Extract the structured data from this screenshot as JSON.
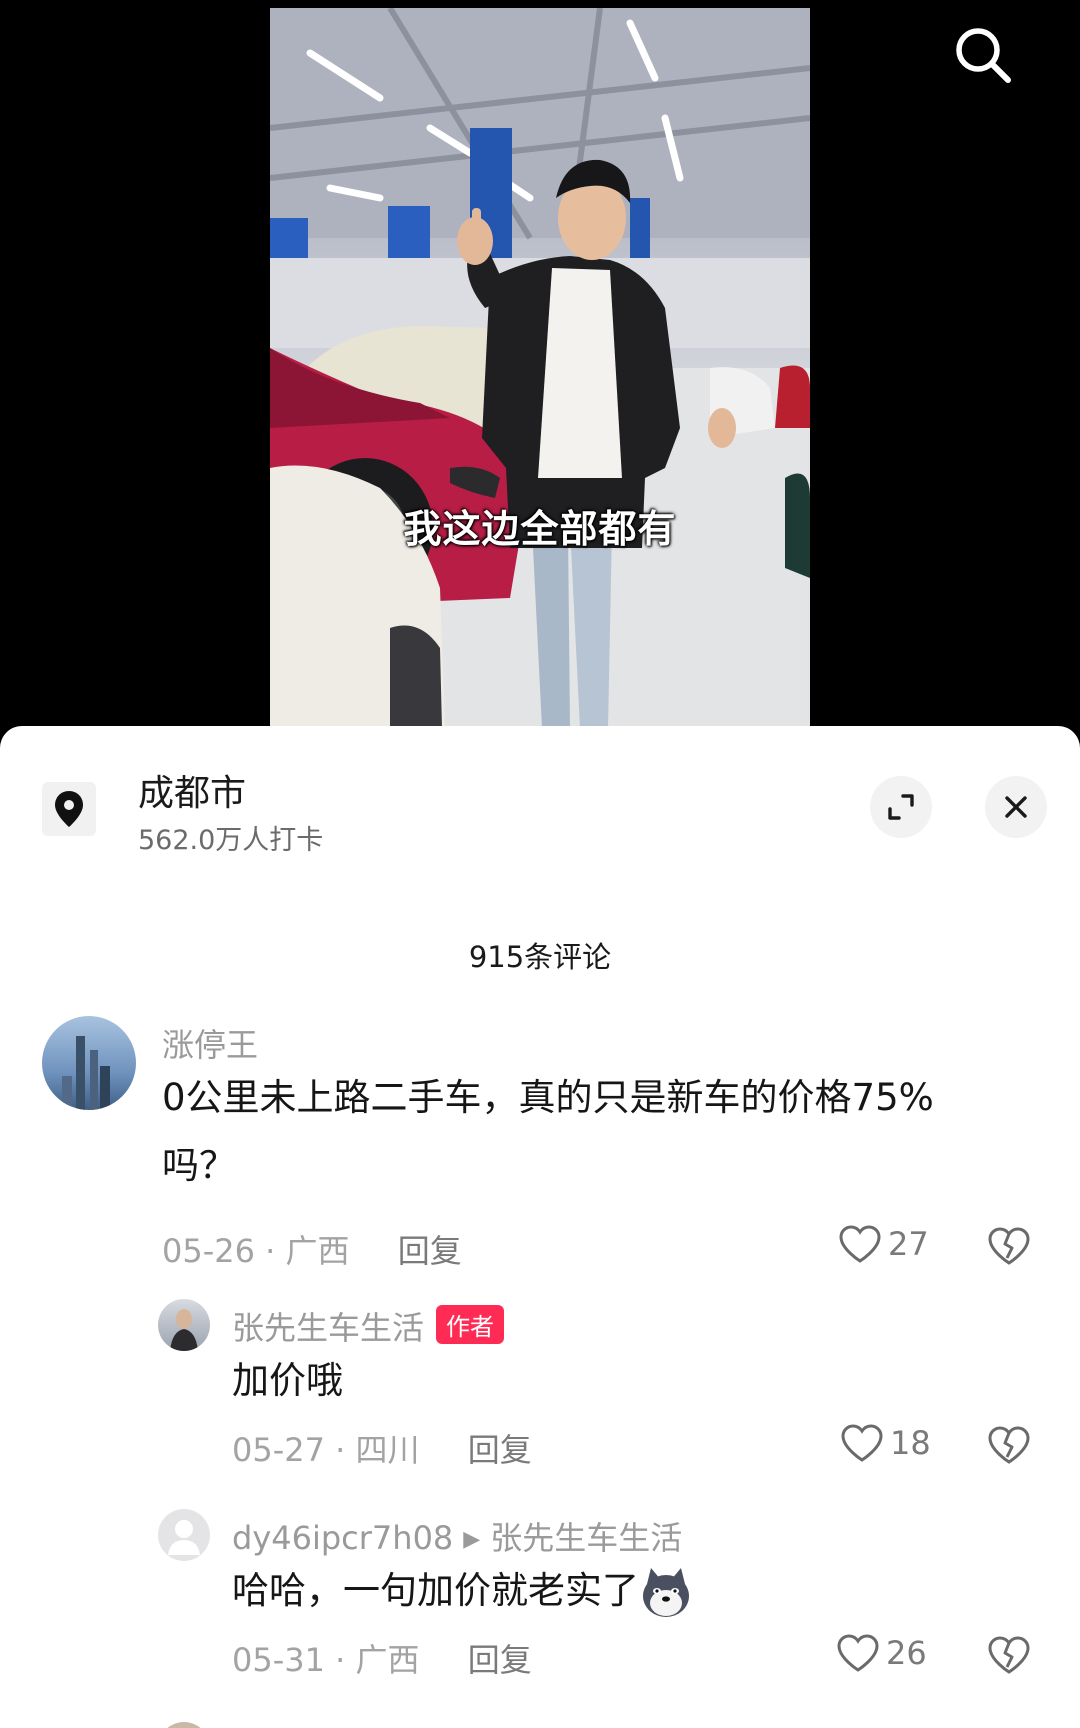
{
  "video": {
    "subtitle": "我这边全部都有"
  },
  "location": {
    "name": "成都市",
    "checkins": "562.0万人打卡"
  },
  "comments_header": {
    "count_label": "915条评论"
  },
  "comments": [
    {
      "author": "涨停王",
      "text": "0公里未上路二手车，真的只是新车的价格75%吗？",
      "date": "05-26",
      "region": "广西",
      "reply_label": "回复",
      "likes": "27"
    },
    {
      "author": "张先生车生活",
      "badge": "作者",
      "text": "加价哦",
      "date": "05-27",
      "region": "四川",
      "reply_label": "回复",
      "likes": "18"
    },
    {
      "author": "dy46ipcr7h08",
      "reply_to": "张先生车生活",
      "text": "哈哈，一句加价就老实了",
      "date": "05-31",
      "region": "广西",
      "reply_label": "回复",
      "likes": "26"
    }
  ],
  "meta_separator": "·",
  "reply_arrow": "▶"
}
